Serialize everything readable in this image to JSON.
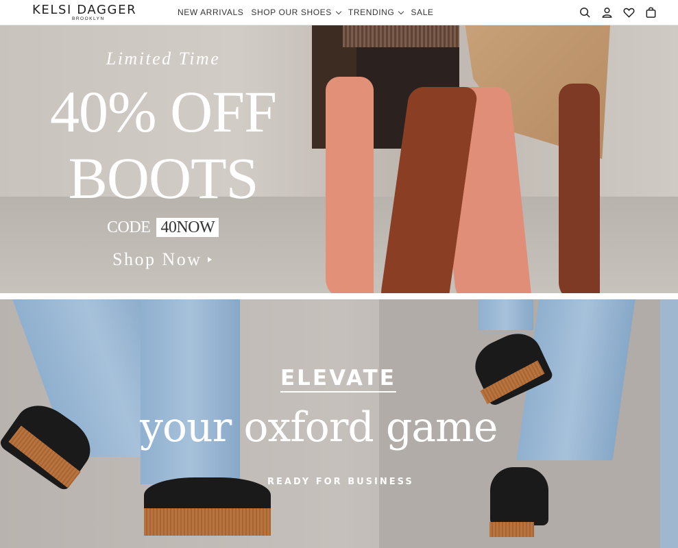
{
  "header": {
    "logo_main": "KELSI DAGGER",
    "logo_sub": "BROOKLYN",
    "nav": [
      {
        "label": "NEW ARRIVALS",
        "dropdown": false
      },
      {
        "label": "SHOP OUR SHOES",
        "dropdown": true
      },
      {
        "label": "TRENDING",
        "dropdown": true
      },
      {
        "label": "SALE",
        "dropdown": false
      }
    ],
    "icons": [
      "search-icon",
      "account-icon",
      "wishlist-heart-icon",
      "cart-bag-icon"
    ]
  },
  "hero_boots": {
    "eyebrow": "Limited Time",
    "headline_line1": "40% OFF",
    "headline_line2": "BOOTS",
    "code_label": "CODE",
    "code_value": "40NOW",
    "cta": "Shop Now"
  },
  "hero_oxford": {
    "kicker": "ELEVATE",
    "headline": "your oxford game",
    "subline": "READY FOR BUSINESS"
  },
  "colors": {
    "text_dark": "#222222",
    "hero_text": "#ffffff"
  }
}
